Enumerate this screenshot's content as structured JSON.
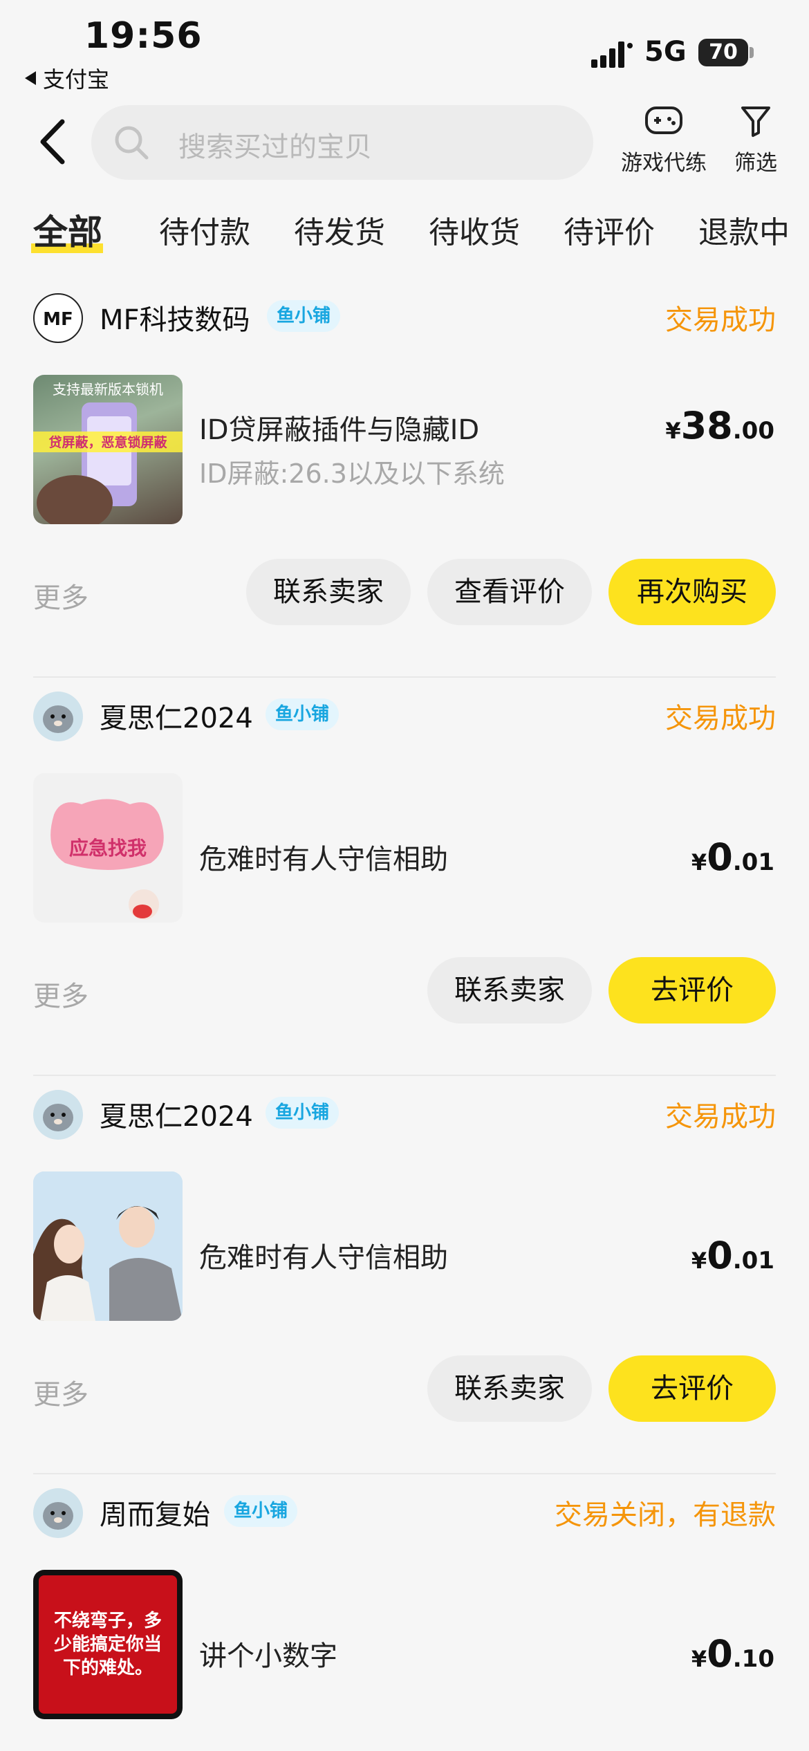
{
  "status_bar": {
    "time": "19:56",
    "back_app": "支付宝",
    "network": "5G",
    "battery": "70"
  },
  "search": {
    "placeholder": "搜索买过的宝贝"
  },
  "tools": {
    "game": "游戏代练",
    "filter": "筛选"
  },
  "tabs": [
    "全部",
    "待付款",
    "待发货",
    "待收货",
    "待评价",
    "退款中"
  ],
  "orders": [
    {
      "shop": "MF科技数码",
      "badge": "鱼小铺",
      "status": "交易成功",
      "title": "ID贷屏蔽插件与隐藏ID",
      "subtitle": "ID屏蔽:26.3以及以下系统",
      "price_currency": "¥",
      "price_int": "38",
      "price_dec": ".00",
      "more": "更多",
      "thumb_text_top": "支持最新版本锁机",
      "thumb_text_mid": "贷屏蔽，恶意锁屏蔽",
      "buttons": [
        "联系卖家",
        "查看评价",
        "再次购买"
      ]
    },
    {
      "shop": "夏思仁2024",
      "badge": "鱼小铺",
      "status": "交易成功",
      "title": "危难时有人守信相助",
      "price_currency": "¥",
      "price_int": "0",
      "price_dec": ".01",
      "more": "更多",
      "thumb_text": "应急找我",
      "buttons": [
        "联系卖家",
        "去评价"
      ]
    },
    {
      "shop": "夏思仁2024",
      "badge": "鱼小铺",
      "status": "交易成功",
      "title": "危难时有人守信相助",
      "price_currency": "¥",
      "price_int": "0",
      "price_dec": ".01",
      "more": "更多",
      "buttons": [
        "联系卖家",
        "去评价"
      ]
    },
    {
      "shop": "周而复始",
      "badge": "鱼小铺",
      "status": "交易关闭，有退款",
      "title": "讲个小数字",
      "price_currency": "¥",
      "price_int": "0",
      "price_dec": ".10",
      "thumb_text": "不绕弯子，多少能搞定你当下的难处。"
    }
  ],
  "colors": {
    "accent_yellow": "#fde21e",
    "status_orange": "#f5950a",
    "badge_blue": "#18a6e0"
  }
}
